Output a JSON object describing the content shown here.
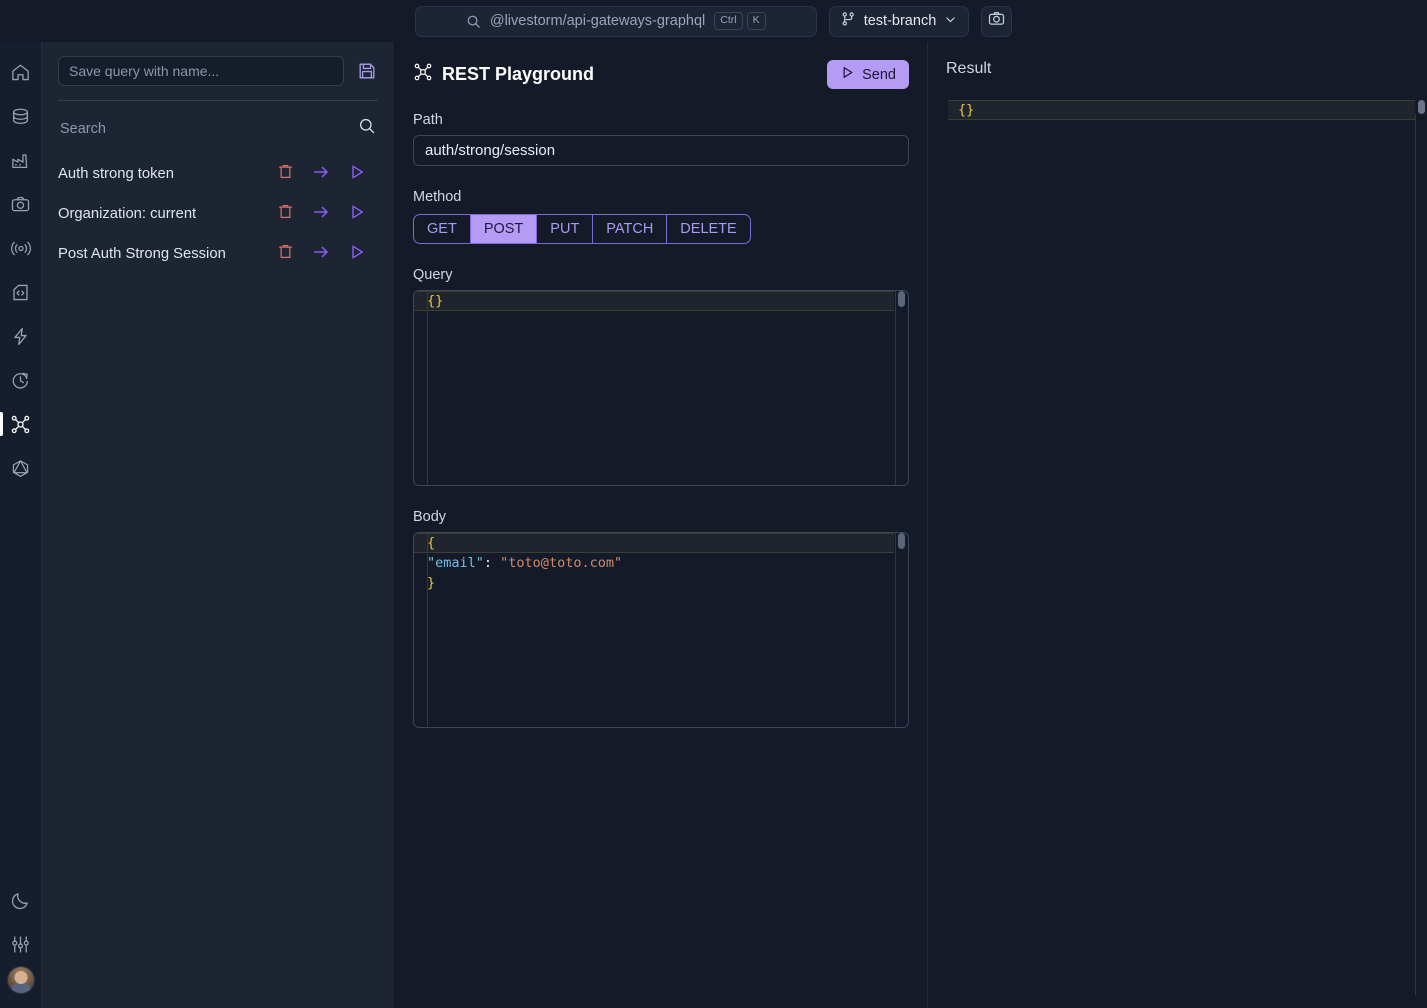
{
  "topbar": {
    "search": {
      "icon": "search-icon",
      "value": "@livestorm/api-gateways-graphql",
      "placeholder": "Search",
      "kbd_ctrl": "Ctrl",
      "kbd_key": "K"
    },
    "branch": {
      "icon": "branch-icon",
      "label": "test-branch",
      "chevron": "chevron-down-icon"
    },
    "camera": {
      "icon": "camera-icon",
      "label": ""
    }
  },
  "rail": {
    "items": [
      {
        "icon": "home-icon",
        "name": "home",
        "active": false
      },
      {
        "icon": "database-icon",
        "name": "database",
        "active": false
      },
      {
        "icon": "factory-icon",
        "name": "factory",
        "active": false
      },
      {
        "icon": "camera-icon",
        "name": "camera",
        "active": false
      },
      {
        "icon": "broadcast-icon",
        "name": "broadcast",
        "active": false
      },
      {
        "icon": "code-file-icon",
        "name": "code-file",
        "active": false
      },
      {
        "icon": "lightning-icon",
        "name": "lightning",
        "active": false
      },
      {
        "icon": "history-icon",
        "name": "history",
        "active": false
      },
      {
        "icon": "network-icon",
        "name": "rest-playground",
        "active": true
      },
      {
        "icon": "graphql-icon",
        "name": "graphql",
        "active": false
      }
    ],
    "bottom": [
      {
        "icon": "moon-icon",
        "name": "dark-mode"
      },
      {
        "icon": "sliders-icon",
        "name": "settings"
      }
    ],
    "avatar": "user-avatar"
  },
  "left_panel": {
    "save_input_placeholder": "Save query with name...",
    "save_input_value": "",
    "save_button_icon": "save-disk-icon",
    "search_placeholder": "Search",
    "search_value": "",
    "search_icon": "search-icon",
    "queries": [
      {
        "name": "Auth strong token",
        "delete_icon": "trash-icon",
        "open_icon": "arrow-right-icon",
        "run_icon": "play-icon"
      },
      {
        "name": "Organization: current",
        "delete_icon": "trash-icon",
        "open_icon": "arrow-right-icon",
        "run_icon": "play-icon"
      },
      {
        "name": "Post Auth Strong Session",
        "delete_icon": "trash-icon",
        "open_icon": "arrow-right-icon",
        "run_icon": "play-icon"
      }
    ]
  },
  "playground": {
    "title": "REST Playground",
    "title_icon": "network-icon",
    "send_label": "Send",
    "send_icon": "play-icon",
    "path_label": "Path",
    "path_value": "auth/strong/session",
    "method_label": "Method",
    "methods": [
      "GET",
      "POST",
      "PUT",
      "PATCH",
      "DELETE"
    ],
    "method_selected": "POST",
    "query_label": "Query",
    "query_code": "{}",
    "body_label": "Body",
    "body_code_brace_open": "{",
    "body_code_key": "\"email\"",
    "body_code_colon": ": ",
    "body_code_value": "\"toto@toto.com\"",
    "body_code_brace_close": "}"
  },
  "result": {
    "title": "Result",
    "code": "{}"
  },
  "colors": {
    "accent_purple": "#b49cf5",
    "accent_purple_border": "#7c6ad6",
    "danger_red": "#e06c6c",
    "background": "#141a28",
    "panel_background": "#1d2533",
    "rail_background": "#161d2d",
    "json_brace": "#e7c547",
    "json_key": "#73bfe2",
    "json_string": "#d08a6a"
  }
}
